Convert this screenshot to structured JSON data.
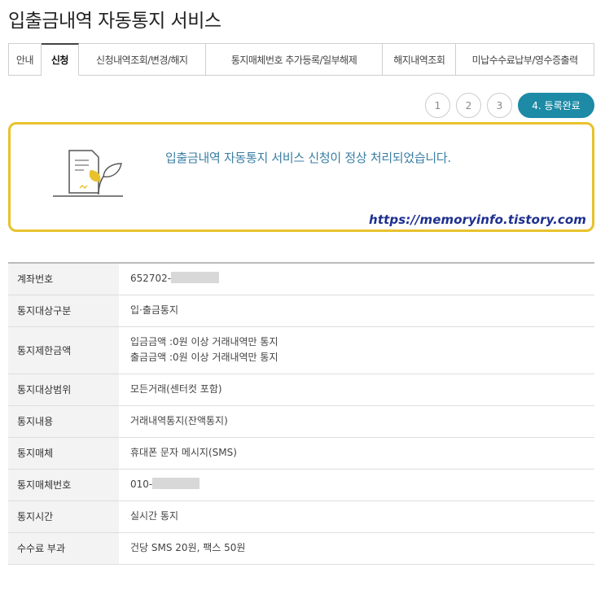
{
  "page": {
    "title": "입출금내역 자동통지 서비스"
  },
  "tabs": [
    {
      "label": "안내"
    },
    {
      "label": "신청"
    },
    {
      "label": "신청내역조회/변경/해지"
    },
    {
      "label": "통지매체번호 추가등록/일부해제"
    },
    {
      "label": "해지내역조회"
    },
    {
      "label": "미납수수료납부/영수증출력"
    }
  ],
  "steps": [
    {
      "label": "1"
    },
    {
      "label": "2"
    },
    {
      "label": "3"
    },
    {
      "label": "4. 등록완료"
    }
  ],
  "notice": {
    "message": "입출금내역 자동통지 서비스 신청이 정상 처리되었습니다.",
    "watermark": "https://memoryinfo.tistory.com",
    "icon": "document-with-leaf-icon"
  },
  "table": {
    "rows": [
      {
        "label": "계좌번호",
        "value": "652702-"
      },
      {
        "label": "통지대상구분",
        "value": "입·출금통지"
      },
      {
        "label": "통지제한금액",
        "value": "입금금액 :0원 이상 거래내역만 통지",
        "value2": "출금금액 :0원 이상 거래내역만 통지"
      },
      {
        "label": "통지대상범위",
        "value": "모든거래(센터컷 포함)"
      },
      {
        "label": "통지내용",
        "value": "거래내역통지(잔액통지)"
      },
      {
        "label": "통지매체",
        "value": "휴대폰 문자 메시지(SMS)"
      },
      {
        "label": "통지매체번호",
        "value": "010-"
      },
      {
        "label": "통지시간",
        "value": "실시간 통지"
      },
      {
        "label": "수수료 부과",
        "value": "건당 SMS 20원, 팩스 50원"
      }
    ]
  },
  "colors": {
    "accent": "#1d8aa6",
    "notice_border": "#e8c22c",
    "notice_text": "#3a7ea3",
    "watermark": "#1d2f8f"
  }
}
